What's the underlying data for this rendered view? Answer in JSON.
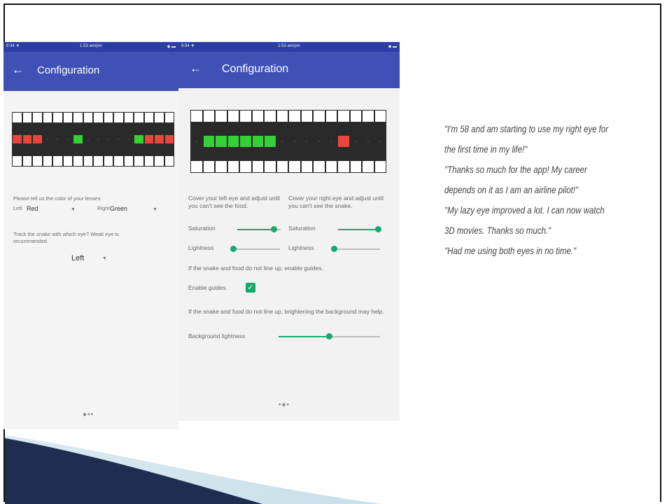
{
  "phone1": {
    "status_left": "9:34 ▼",
    "status_center": "1:53 am/pm",
    "status_right": "◆ ▬",
    "back_icon": "←",
    "title": "Configuration",
    "lens_prompt": "Please tell us the color of your lenses:",
    "left_label": "Left",
    "left_value": "Red",
    "right_label": "Right",
    "right_value": "Green",
    "dropdown_icon": "▼",
    "track_prompt": "Track the snake with which eye? Weak eye is recommended.",
    "track_value": "Left",
    "page_dots": "●••",
    "grid": {
      "cols": 15,
      "cells": [
        "R",
        "R",
        "R",
        "",
        "",
        "",
        "G",
        "",
        "",
        "",
        "",
        "",
        "G",
        "R",
        "R",
        "R"
      ]
    }
  },
  "phone2": {
    "status_left": "9:34 ▼",
    "status_center": "1:53 am/pm",
    "status_right": "◆ ▬",
    "back_icon": "←",
    "title": "Configuration",
    "left_instruction": "Cover your left eye and adjust until you can't see the food.",
    "right_instruction": "Cover your right eye and adjust until you can't see the snake.",
    "saturation_label": "Saturation",
    "lightness_label": "Lightness",
    "left_saturation": 0.85,
    "left_lightness": 0.05,
    "right_saturation": 0.95,
    "right_lightness": 0.05,
    "guides_prompt": "If the snake and food do not line up, enable guides.",
    "guides_label": "Enable guides",
    "guides_checked": true,
    "check_icon": "✓",
    "background_prompt": "If the snake and food do not line up, brightening the background may help.",
    "background_label": "Background lightness",
    "background_lightness": 0.5,
    "page_dots": "•●•",
    "grid": {
      "cols": 16,
      "cells": [
        "",
        "G",
        "G",
        "G",
        "G",
        "G",
        "G",
        "",
        "",
        "",
        "",
        "",
        "R",
        "",
        "",
        ""
      ]
    }
  },
  "quotes": [
    "\"I'm 58 and am starting to use my right eye for the first time in my life!\"",
    "\"Thanks so much for the app! My career depends on it as I am an airline pilot!\"",
    "\"My lazy eye improved a lot. I can now watch 3D movies. Thanks so much.\"",
    "\"Had me using both eyes in no time.\""
  ],
  "colors": {
    "appbar": "#3f51b5",
    "statusbar": "#2c3ea6",
    "snake_red": "#e8453c",
    "snake_green": "#35d035",
    "accent": "#17a86f",
    "swoosh_dark": "#1c2b4c",
    "swoosh_light": "#d3e6ef"
  }
}
